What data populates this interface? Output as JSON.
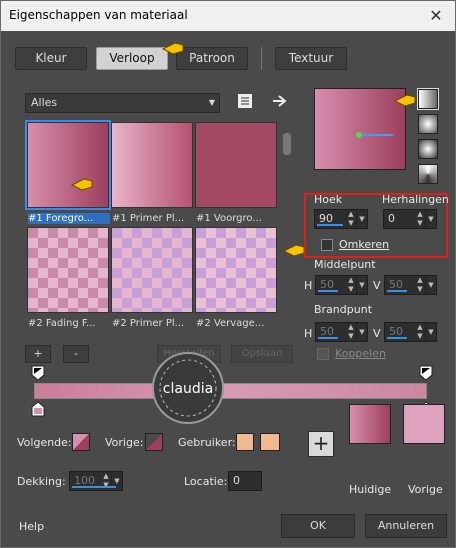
{
  "window": {
    "title": "Eigenschappen van materiaal",
    "close": "✕"
  },
  "tabs": [
    "Kleur",
    "Verloop",
    "Patroon",
    "Textuur"
  ],
  "dropdown": {
    "value": "Alles"
  },
  "swatches": [
    "#1 Foregro...",
    "#1 Primer Pl...",
    "#1 Voorgro...",
    "#2 Fading F...",
    "#2 Primer Pl...",
    "#2 Vervage..."
  ],
  "list_buttons": {
    "add": "+",
    "remove": "-",
    "restore": "Herstellen",
    "save": "Opslaan"
  },
  "settings": {
    "angle_label": "Hoek",
    "angle": "90",
    "repeat_label": "Herhalingen",
    "repeat": "0",
    "invert_label": "Omkeren",
    "center_label": "Middelpunt",
    "h_label": "H",
    "v_label": "V",
    "center_h": "50",
    "center_v": "50",
    "focal_label": "Brandpunt",
    "focal_h": "50",
    "focal_v": "50",
    "link_label": "Koppelen"
  },
  "stops": {
    "next_label": "Volgende:",
    "prev_label": "Vorige:",
    "user_label": "Gebruiker:",
    "opacity_label": "Dekking:",
    "opacity": "100",
    "location_label": "Locatie:",
    "location": "0"
  },
  "colors": {
    "current_label": "Huidige",
    "previous_label": "Vorige",
    "plus": "+",
    "dark": "#9c3f5c",
    "light": "#dfa2bf",
    "user": "#f1b990"
  },
  "footer": {
    "help": "Help",
    "ok": "OK",
    "cancel": "Annuleren"
  },
  "watermark": "claudia"
}
